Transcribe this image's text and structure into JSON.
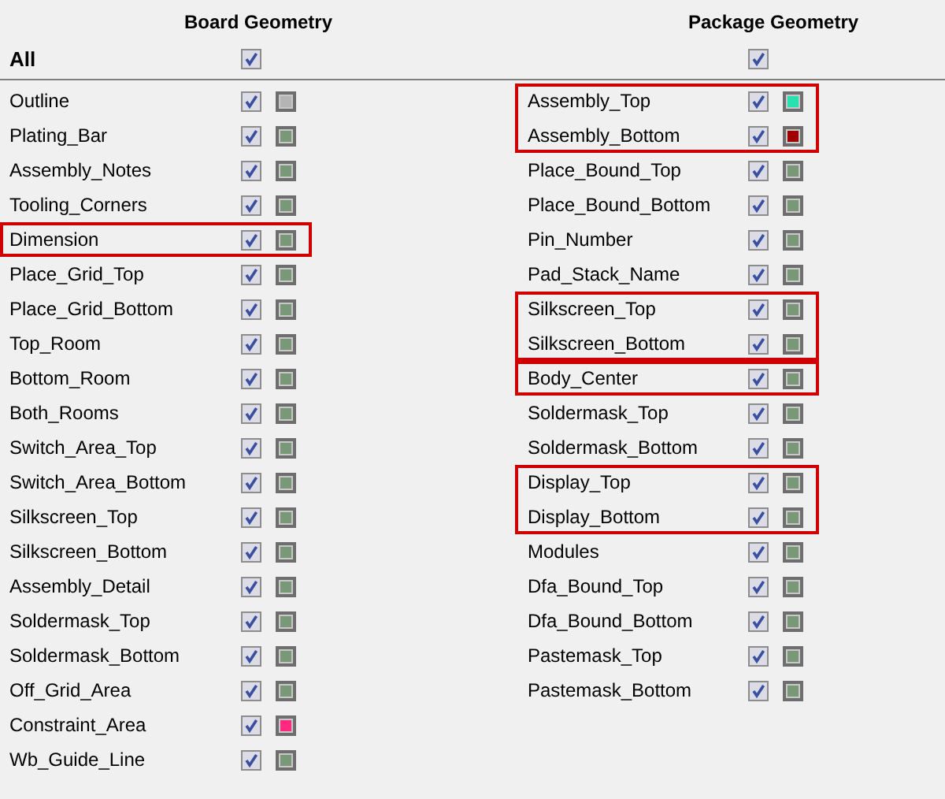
{
  "all_label": "All",
  "columns": [
    {
      "title": "Board Geometry",
      "all_checked": true,
      "items": [
        {
          "kind": "layer",
          "name": "Outline",
          "checked": true,
          "color": "#b4b4b4"
        },
        {
          "kind": "layer",
          "name": "Plating_Bar",
          "checked": true,
          "color": "#789878"
        },
        {
          "kind": "layer",
          "name": "Assembly_Notes",
          "checked": true,
          "color": "#789878"
        },
        {
          "kind": "layer",
          "name": "Tooling_Corners",
          "checked": true,
          "color": "#789878"
        },
        {
          "kind": "frame",
          "layers": [
            {
              "name": "Dimension",
              "checked": true,
              "color": "#789878"
            }
          ]
        },
        {
          "kind": "layer",
          "name": "Place_Grid_Top",
          "checked": true,
          "color": "#789878"
        },
        {
          "kind": "layer",
          "name": "Place_Grid_Bottom",
          "checked": true,
          "color": "#789878"
        },
        {
          "kind": "layer",
          "name": "Top_Room",
          "checked": true,
          "color": "#789878"
        },
        {
          "kind": "layer",
          "name": "Bottom_Room",
          "checked": true,
          "color": "#789878"
        },
        {
          "kind": "layer",
          "name": "Both_Rooms",
          "checked": true,
          "color": "#789878"
        },
        {
          "kind": "layer",
          "name": "Switch_Area_Top",
          "checked": true,
          "color": "#789878"
        },
        {
          "kind": "layer",
          "name": "Switch_Area_Bottom",
          "checked": true,
          "color": "#789878"
        },
        {
          "kind": "layer",
          "name": "Silkscreen_Top",
          "checked": true,
          "color": "#789878"
        },
        {
          "kind": "layer",
          "name": "Silkscreen_Bottom",
          "checked": true,
          "color": "#789878"
        },
        {
          "kind": "layer",
          "name": "Assembly_Detail",
          "checked": true,
          "color": "#789878"
        },
        {
          "kind": "layer",
          "name": "Soldermask_Top",
          "checked": true,
          "color": "#789878"
        },
        {
          "kind": "layer",
          "name": "Soldermask_Bottom",
          "checked": true,
          "color": "#789878"
        },
        {
          "kind": "layer",
          "name": "Off_Grid_Area",
          "checked": true,
          "color": "#789878"
        },
        {
          "kind": "layer",
          "name": "Constraint_Area",
          "checked": true,
          "color": "#ff2a80"
        },
        {
          "kind": "layer",
          "name": "Wb_Guide_Line",
          "checked": true,
          "color": "#789878"
        }
      ]
    },
    {
      "title": "Package Geometry",
      "all_checked": true,
      "items": [
        {
          "kind": "frame",
          "layers": [
            {
              "name": "Assembly_Top",
              "checked": true,
              "color": "#28e0b0"
            },
            {
              "name": "Assembly_Bottom",
              "checked": true,
              "color": "#a00000"
            }
          ]
        },
        {
          "kind": "layer",
          "name": "Place_Bound_Top",
          "checked": true,
          "color": "#789878"
        },
        {
          "kind": "layer",
          "name": "Place_Bound_Bottom",
          "checked": true,
          "color": "#789878"
        },
        {
          "kind": "layer",
          "name": "Pin_Number",
          "checked": true,
          "color": "#789878"
        },
        {
          "kind": "layer",
          "name": "Pad_Stack_Name",
          "checked": true,
          "color": "#789878"
        },
        {
          "kind": "frame",
          "layers": [
            {
              "name": "Silkscreen_Top",
              "checked": true,
              "color": "#789878"
            },
            {
              "name": "Silkscreen_Bottom",
              "checked": true,
              "color": "#789878"
            }
          ]
        },
        {
          "kind": "frame",
          "layers": [
            {
              "name": "Body_Center",
              "checked": true,
              "color": "#789878"
            }
          ]
        },
        {
          "kind": "layer",
          "name": "Soldermask_Top",
          "checked": true,
          "color": "#789878"
        },
        {
          "kind": "layer",
          "name": "Soldermask_Bottom",
          "checked": true,
          "color": "#789878"
        },
        {
          "kind": "frame",
          "layers": [
            {
              "name": "Display_Top",
              "checked": true,
              "color": "#789878"
            },
            {
              "name": "Display_Bottom",
              "checked": true,
              "color": "#789878"
            }
          ]
        },
        {
          "kind": "layer",
          "name": "Modules",
          "checked": true,
          "color": "#789878"
        },
        {
          "kind": "layer",
          "name": "Dfa_Bound_Top",
          "checked": true,
          "color": "#789878"
        },
        {
          "kind": "layer",
          "name": "Dfa_Bound_Bottom",
          "checked": true,
          "color": "#789878"
        },
        {
          "kind": "layer",
          "name": "Pastemask_Top",
          "checked": true,
          "color": "#789878"
        },
        {
          "kind": "layer",
          "name": "Pastemask_Bottom",
          "checked": true,
          "color": "#789878"
        }
      ]
    }
  ]
}
